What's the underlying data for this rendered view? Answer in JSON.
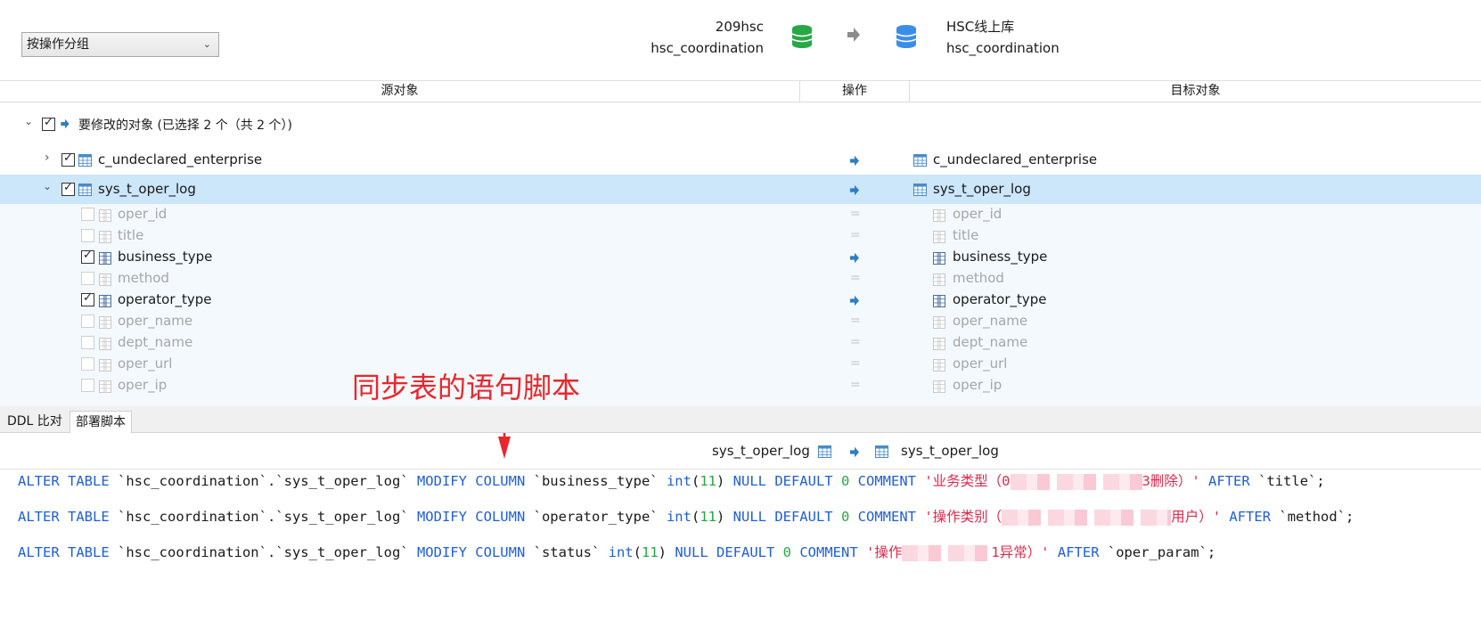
{
  "header": {
    "group_select": "按操作分组",
    "source": {
      "connection": "209hsc",
      "database": "hsc_coordination",
      "db_color": "#28a745"
    },
    "target": {
      "connection": "HSC线上库",
      "database": "hsc_coordination",
      "db_color": "#3b8ee8"
    }
  },
  "columns": {
    "source": "源对象",
    "operation": "操作",
    "target": "目标对象"
  },
  "group": {
    "label": "要修改的对象 (已选择 2 个（共 2 个）)"
  },
  "tables": [
    {
      "source": "c_undeclared_enterprise",
      "target": "c_undeclared_enterprise"
    },
    {
      "source": "sys_t_oper_log",
      "target": "sys_t_oper_log"
    }
  ],
  "fields": [
    {
      "name": "oper_id",
      "changed": false
    },
    {
      "name": "title",
      "changed": false
    },
    {
      "name": "business_type",
      "changed": true
    },
    {
      "name": "method",
      "changed": false
    },
    {
      "name": "operator_type",
      "changed": true
    },
    {
      "name": "oper_name",
      "changed": false
    },
    {
      "name": "dept_name",
      "changed": false
    },
    {
      "name": "oper_url",
      "changed": false
    },
    {
      "name": "oper_ip",
      "changed": false
    }
  ],
  "annotation": "同步表的语句脚本",
  "tabs": {
    "ddl": "DDL 比对",
    "deploy": "部署脚本"
  },
  "script_header": {
    "source": "sys_t_oper_log",
    "target": "sys_t_oper_log"
  },
  "script": {
    "l1": {
      "pre": "`hsc_coordination`.`sys_t_oper_log`",
      "col": "`business_type`",
      "comment_a": "'业务类型（0",
      "comment_b": "3删除）'",
      "after": "`title`;"
    },
    "l2": {
      "pre": "`hsc_coordination`.`sys_t_oper_log`",
      "col": "`operator_type`",
      "comment_a": "'操作类别（",
      "comment_b": "用户）'",
      "after": "`method`;"
    },
    "l3": {
      "pre": "`hsc_coordination`.`sys_t_oper_log`",
      "col": "`status`",
      "comment_a": "'操作",
      "comment_b": "1异常）'",
      "after": "`oper_param`;"
    },
    "kw": {
      "alter": "ALTER TABLE",
      "modify": "MODIFY COLUMN",
      "type": "int",
      "len": "11",
      "null": "NULL DEFAULT",
      "zero": "0",
      "comment": "COMMENT",
      "after": "AFTER"
    }
  },
  "icons": [
    "chevron-down-icon",
    "database-icon",
    "arrow-right-icon",
    "table-icon",
    "column-icon",
    "checkbox-icon"
  ]
}
